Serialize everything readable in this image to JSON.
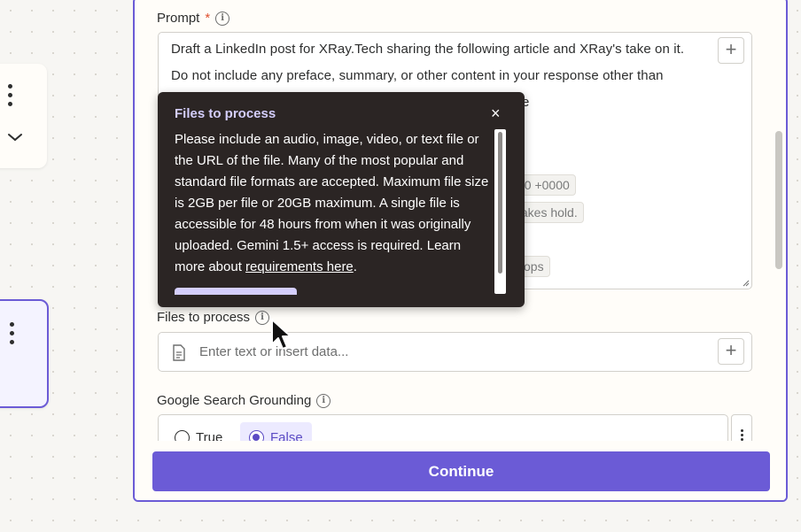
{
  "prompt": {
    "label": "Prompt",
    "required_mark": "*",
    "lines": [
      "Draft a LinkedIn post for XRay.Tech sharing the following article and XRay's take on it.",
      "Do not include any preface, summary, or other content in your response other than",
      "e"
    ],
    "pills": [
      "00 +0000",
      "takes hold.",
      "vops"
    ]
  },
  "tooltip": {
    "title": "Files to process",
    "close_glyph": "×",
    "body": "Please include an audio, image, video, or text file or the URL of the file. Many of the most popular and standard file formats are accepted. Maximum file size is 2GB per file or 20GB maximum. A single file is accessible for 48 hours from when it was originally uploaded. Gemini 1.5+ access is required. Learn more about ",
    "link_text": "requirements here",
    "body_end": "."
  },
  "files": {
    "label": "Files to process",
    "placeholder": "Enter text or insert data..."
  },
  "grounding": {
    "label": "Google Search Grounding",
    "options": [
      "True",
      "False"
    ],
    "selected": "False"
  },
  "footer": {
    "continue_label": "Continue"
  },
  "plus_glyph": "+",
  "colors": {
    "accent": "#6b5bd6",
    "tooltip_bg": "#2b2524",
    "tooltip_title": "#d4cefc",
    "required": "#e0502f"
  }
}
